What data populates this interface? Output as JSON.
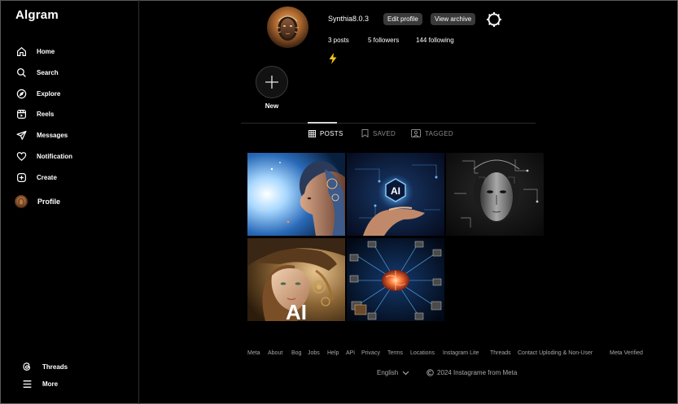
{
  "app": {
    "logo": "Algram"
  },
  "sidebar": {
    "items": [
      {
        "label": "Home",
        "icon": "home-icon"
      },
      {
        "label": "Search",
        "icon": "search-icon"
      },
      {
        "label": "Explore",
        "icon": "compass-icon"
      },
      {
        "label": "Reels",
        "icon": "reels-icon"
      },
      {
        "label": "Messages",
        "icon": "send-icon"
      },
      {
        "label": "Notification",
        "icon": "heart-icon"
      },
      {
        "label": "Create",
        "icon": "plus-square-icon"
      },
      {
        "label": "Profile",
        "icon": "avatar"
      }
    ],
    "bottom": [
      {
        "label": "Threads",
        "icon": "threads-icon"
      },
      {
        "label": "More",
        "icon": "menu-icon"
      }
    ]
  },
  "profile": {
    "username": "Synthia8.0.3",
    "edit_label": "Edit profile",
    "archive_label": "View archive",
    "posts": "3 posts",
    "followers": "5 followers",
    "following": "144 following",
    "bio_icon": "lightning-icon"
  },
  "highlights": {
    "new_label": "New"
  },
  "tabs": [
    {
      "label": "POSTS",
      "active": true
    },
    {
      "label": "SAVED",
      "active": false
    },
    {
      "label": "TAGGED",
      "active": false
    }
  ],
  "post_text": {
    "ai_badge": "AI",
    "ai_caption": "AI"
  },
  "footer": {
    "links": [
      "Meta",
      "About",
      "Bog",
      "Jobs",
      "Help",
      "APi",
      "Privacy",
      "Terms",
      "Locations",
      "Instagram Lite",
      "Threads",
      "Contact Uploding & Non-User",
      "Meta Verified"
    ],
    "language": "English",
    "copyright": "2024 Instagrame from Meta"
  },
  "colors": {
    "background": "#000000",
    "pill": "#3a3a3a",
    "muted": "#a8a8a8",
    "bolt": "#f5c518"
  }
}
